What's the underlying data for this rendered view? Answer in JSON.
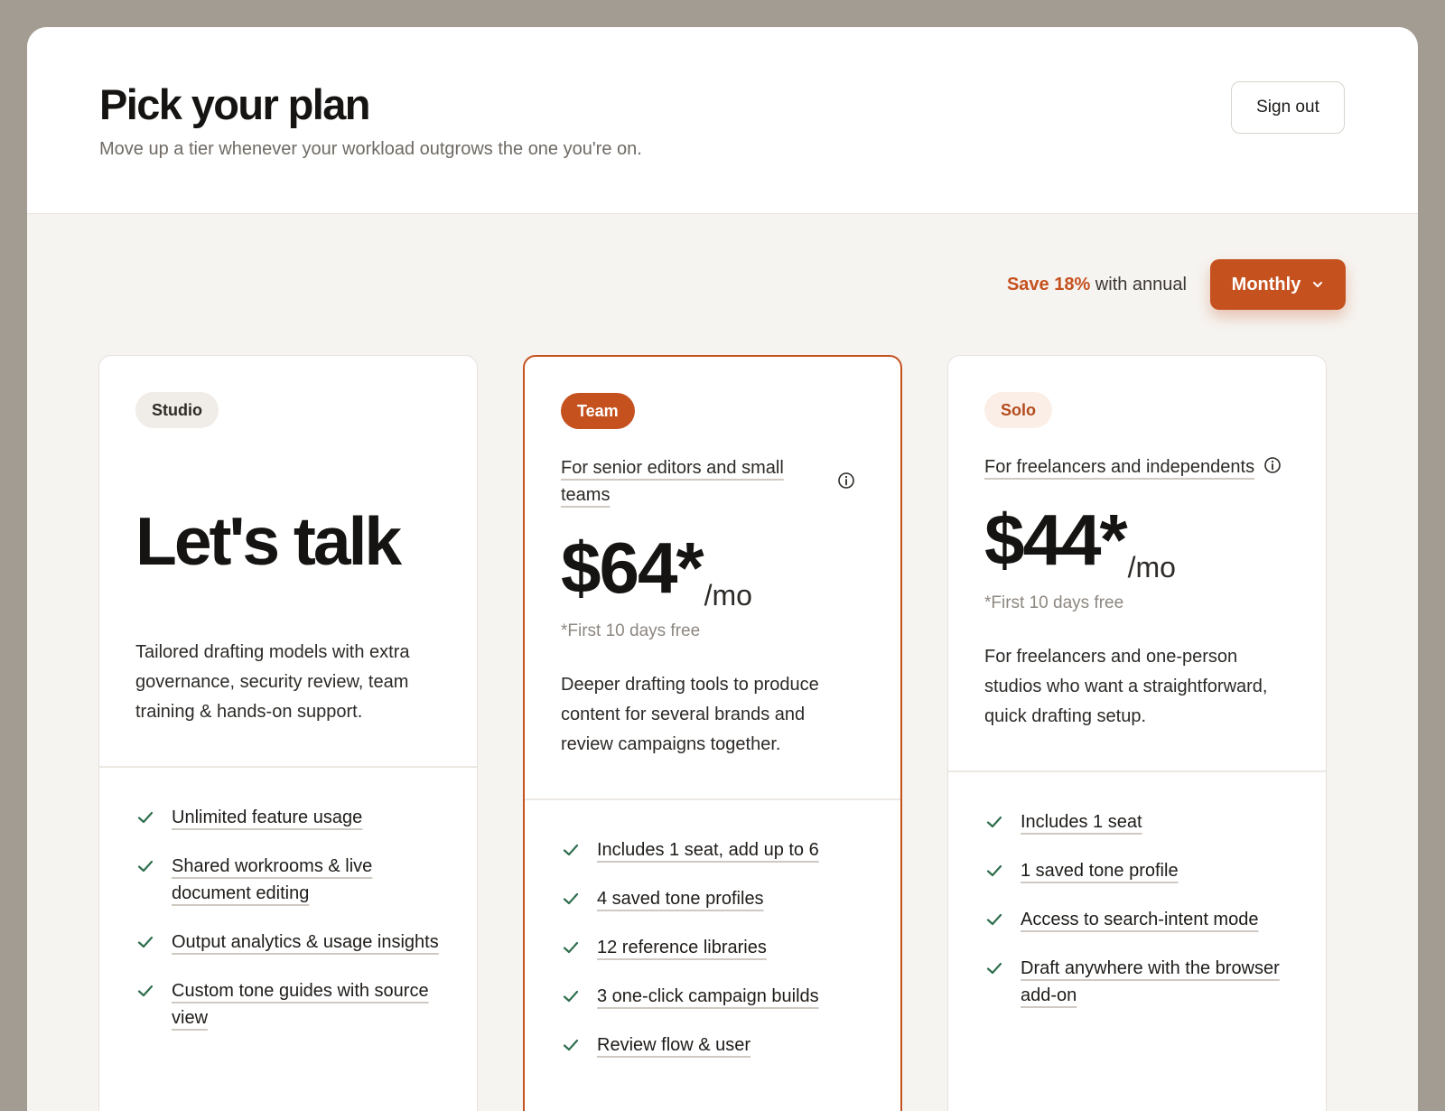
{
  "header": {
    "title": "Pick your plan",
    "subtitle": "Move up a tier whenever your workload outgrows the one you're on.",
    "signout_label": "Sign out"
  },
  "billing": {
    "save_highlight": "Save 18%",
    "save_rest": " with annual",
    "selected_period": "Monthly",
    "accent_color": "#c5511f"
  },
  "plans": [
    {
      "name": "Studio",
      "headline": "Let's talk",
      "description": "Tailored drafting models with extra governance, security review, team training & hands-on support.",
      "features": [
        "Unlimited feature usage",
        "Shared workrooms & live document editing",
        "Output analytics & usage insights",
        "Custom tone guides with source view"
      ]
    },
    {
      "name": "Team",
      "tagline": "For senior editors and small teams",
      "price": "$64*",
      "period": "/mo",
      "trial_note": "*First 10 days free",
      "description": "Deeper drafting tools to produce content for several brands and review campaigns together.",
      "features": [
        "Includes 1 seat, add up to 6",
        "4 saved tone profiles",
        "12 reference libraries",
        "3 one-click campaign builds",
        "Review flow & user"
      ]
    },
    {
      "name": "Solo",
      "tagline": "For freelancers and independents",
      "price": "$44*",
      "period": "/mo",
      "trial_note": "*First 10 days free",
      "description": "For freelancers and one-person studios who want a straightforward, quick drafting setup.",
      "features": [
        "Includes 1 seat",
        "1 saved tone profile",
        "Access to search-intent mode",
        "Draft anywhere with the browser add-on"
      ]
    }
  ],
  "icons": {
    "check": "check-icon",
    "info": "info-icon",
    "dropdown": "chevron-down-icon"
  }
}
